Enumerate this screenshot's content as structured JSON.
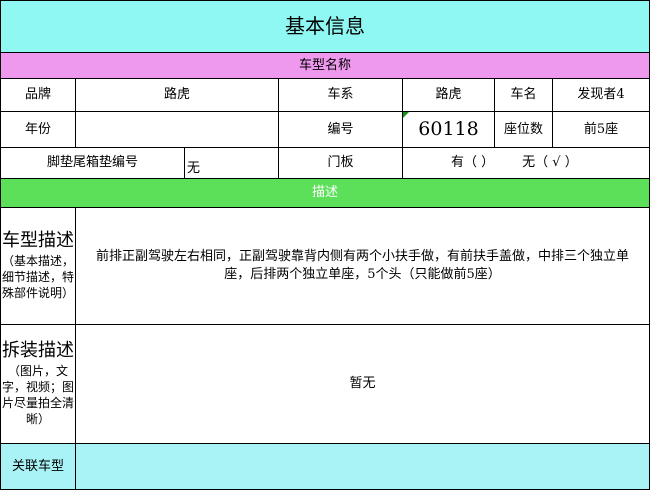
{
  "title": "基本信息",
  "section_model": "车型名称",
  "row1": {
    "brand_label": "品牌",
    "brand_value": "路虎",
    "series_label": "车系",
    "series_value": "路虎",
    "name_label": "车名",
    "name_value": "发现者4"
  },
  "row2": {
    "year_label": "年份",
    "year_value": "",
    "code_label": "编号",
    "code_value": "60118",
    "seats_label": "座位数",
    "seats_value": "前5座"
  },
  "row3": {
    "mat_label": "脚垫尾箱垫编号",
    "mat_value": "无",
    "door_label": "门板",
    "door_yes": "有（      ）",
    "door_no": "无（  √   ）"
  },
  "section_desc": "描述",
  "model_desc": {
    "head": "车型描述",
    "sub": "（基本描述，细节描述，特殊部件说明）",
    "text": "前排正副驾驶左右相同，正副驾驶靠背内侧有两个小扶手做，有前扶手盖做，中排三个独立单座，后排两个独立单座，5个头（只能做前5座）"
  },
  "install_desc": {
    "head": "拆装描述",
    "sub": "（图片，文字，视频；图片尽量拍全清晰）",
    "text": "暂无"
  },
  "related_label": "关联车型",
  "related_value": "",
  "colors": {
    "title_bg": "#8ff8f3",
    "pink_band": "#ee98ee",
    "green_band": "#5ce05a",
    "bottom_bg": "#a9f3f6"
  }
}
